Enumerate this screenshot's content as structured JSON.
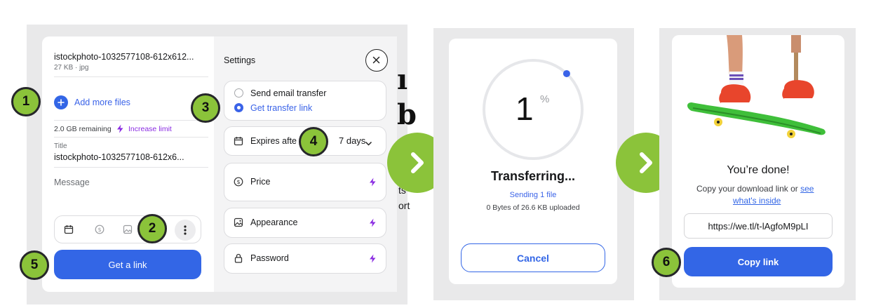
{
  "panel1": {
    "file": {
      "name": "istockphoto-1032577108-612x612...",
      "meta": "27 KB · jpg"
    },
    "add_more": "Add more files",
    "remaining": "2.0 GB remaining",
    "increase": "Increase limit",
    "title_label": "Title",
    "title_value": "istockphoto-1032577108-612x6...",
    "message_placeholder": "Message",
    "get_link": "Get a link",
    "settings": {
      "heading": "Settings",
      "send_email": "Send email transfer",
      "get_transfer_link": "Get transfer link",
      "expires_label": "Expires afte",
      "expires_value": "7 days",
      "price": "Price",
      "appearance": "Appearance",
      "password": "Password"
    },
    "ghost_text": {
      "a": "ı",
      "b": "b",
      "c": "ts",
      "d": "ort"
    }
  },
  "panel2": {
    "percent_number": "1",
    "percent_sign": "%",
    "progress": 0.01,
    "transferring": "Transferring...",
    "sending": "Sending 1 file",
    "uploaded": "0 Bytes of 26.6 KB uploaded",
    "cancel": "Cancel"
  },
  "panel3": {
    "done": "You’re done!",
    "copy_text": "Copy your download link or",
    "see_link_a": "see",
    "see_link_b": "what's inside",
    "url": "https://we.tl/t-lAgfoM9pLI",
    "copy_link": "Copy link"
  },
  "badges": [
    "1",
    "2",
    "3",
    "4",
    "5",
    "6"
  ],
  "colors": {
    "accent_blue": "#3366e6",
    "badge_green": "#8bc33a",
    "boost_purple": "#8a2be2"
  }
}
